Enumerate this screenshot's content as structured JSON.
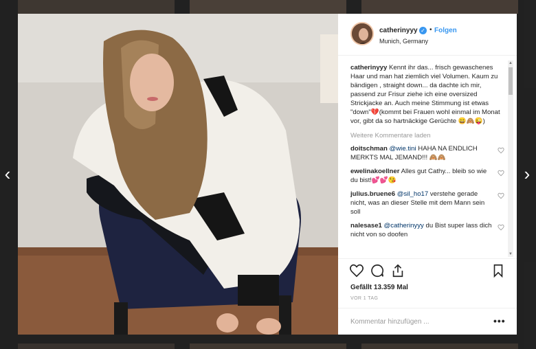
{
  "post": {
    "username": "catherinyyy",
    "follow_label": "Folgen",
    "dot": "•",
    "location": "Munich, Germany",
    "caption": "Kennt ihr das... frisch gewaschenes Haar und man hat ziemlich viel Volumen. Kaum zu bändigen , straight down... da dachte ich mir, passend zur Frisur ziehe ich eine oversized Strickjacke an. Auch meine Stimmung ist etwas \"down\"💔(kommt bei Frauen wohl einmal im Monat vor, gibt da so hartnäckige Gerüchte 😄🙈😜)",
    "more_comments_label": "Weitere Kommentare laden",
    "comments": [
      {
        "user": "doitschman",
        "mention": "@wie.tini",
        "text": "HAHA NA ENDLICH MERKTS MAL JEMAND!!! 🙈🙈"
      },
      {
        "user": "ewelinakoellner",
        "mention": "",
        "text": "Alles gut Cathy... bleib so wie du bist!💕💕😘"
      },
      {
        "user": "julius.bruene6",
        "mention": "@sil_ho17",
        "text": "verstehe gerade nicht, was an dieser Stelle mit dem Mann sein soll"
      },
      {
        "user": "nalesase1",
        "mention": "@catherinyyy",
        "text": "du Bist super lass dich nicht von so doofen"
      }
    ],
    "likes": "Gefällt 13.359 Mal",
    "time": "VOR 1 TAG",
    "comment_placeholder": "Kommentar hinzufügen ...",
    "more_options": "•••"
  },
  "nav": {
    "prev": "‹",
    "next": "›"
  },
  "icons": {
    "like": "heart-icon",
    "comment": "comment-icon",
    "share": "share-icon",
    "save": "bookmark-icon",
    "verified": "verified-badge-icon"
  },
  "colors": {
    "link": "#3897f0",
    "text": "#262626",
    "muted": "#999999",
    "overlay": "#4b4b4b"
  }
}
